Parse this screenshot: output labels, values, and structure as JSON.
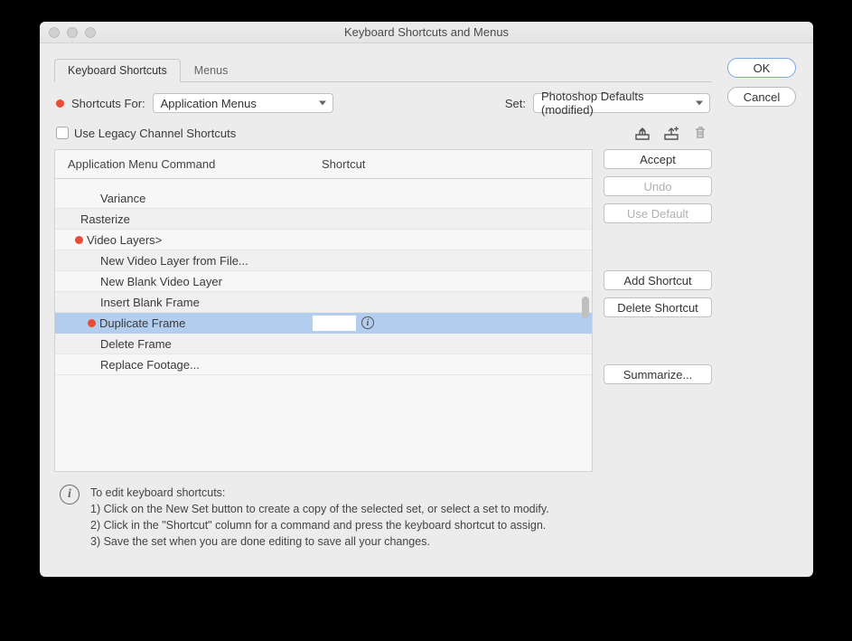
{
  "window": {
    "title": "Keyboard Shortcuts and Menus"
  },
  "tabs": {
    "shortcuts": "Keyboard Shortcuts",
    "menus": "Menus"
  },
  "top": {
    "shortcuts_for_label": "Shortcuts For:",
    "shortcuts_for_value": "Application Menus",
    "set_label": "Set:",
    "set_value": "Photoshop Defaults (modified)",
    "legacy_label": "Use Legacy Channel Shortcuts"
  },
  "table": {
    "header_cmd": "Application Menu Command",
    "header_shortcut": "Shortcut",
    "rows": [
      {
        "label": "Variance",
        "indent": "indent-1",
        "alt": false
      },
      {
        "label": "Rasterize",
        "indent": "indent-0",
        "alt": true
      },
      {
        "label": "Video Layers>",
        "indent": "indent-0",
        "alt": false,
        "marker": true
      },
      {
        "label": "New Video Layer from File...",
        "indent": "indent-1",
        "alt": true
      },
      {
        "label": "New Blank Video Layer",
        "indent": "indent-1",
        "alt": false
      },
      {
        "label": "Insert Blank Frame",
        "indent": "indent-1",
        "alt": true
      },
      {
        "label": "Duplicate Frame",
        "indent": "indent-1",
        "alt": false,
        "selected": true,
        "marker": true,
        "editing": true
      },
      {
        "label": "Delete Frame",
        "indent": "indent-1",
        "alt": true
      },
      {
        "label": "Replace Footage...",
        "indent": "indent-1",
        "alt": false
      }
    ]
  },
  "side": {
    "accept": "Accept",
    "undo": "Undo",
    "use_default": "Use Default",
    "add_shortcut": "Add Shortcut",
    "delete_shortcut": "Delete Shortcut",
    "summarize": "Summarize..."
  },
  "hint": {
    "title": "To edit keyboard shortcuts:",
    "l1": "1) Click on the New Set button to create a copy of the selected set, or select a set to modify.",
    "l2": "2) Click in the \"Shortcut\" column for a command and press the keyboard shortcut to assign.",
    "l3": "3) Save the set when you are done editing to save all your changes."
  },
  "buttons": {
    "ok": "OK",
    "cancel": "Cancel"
  }
}
